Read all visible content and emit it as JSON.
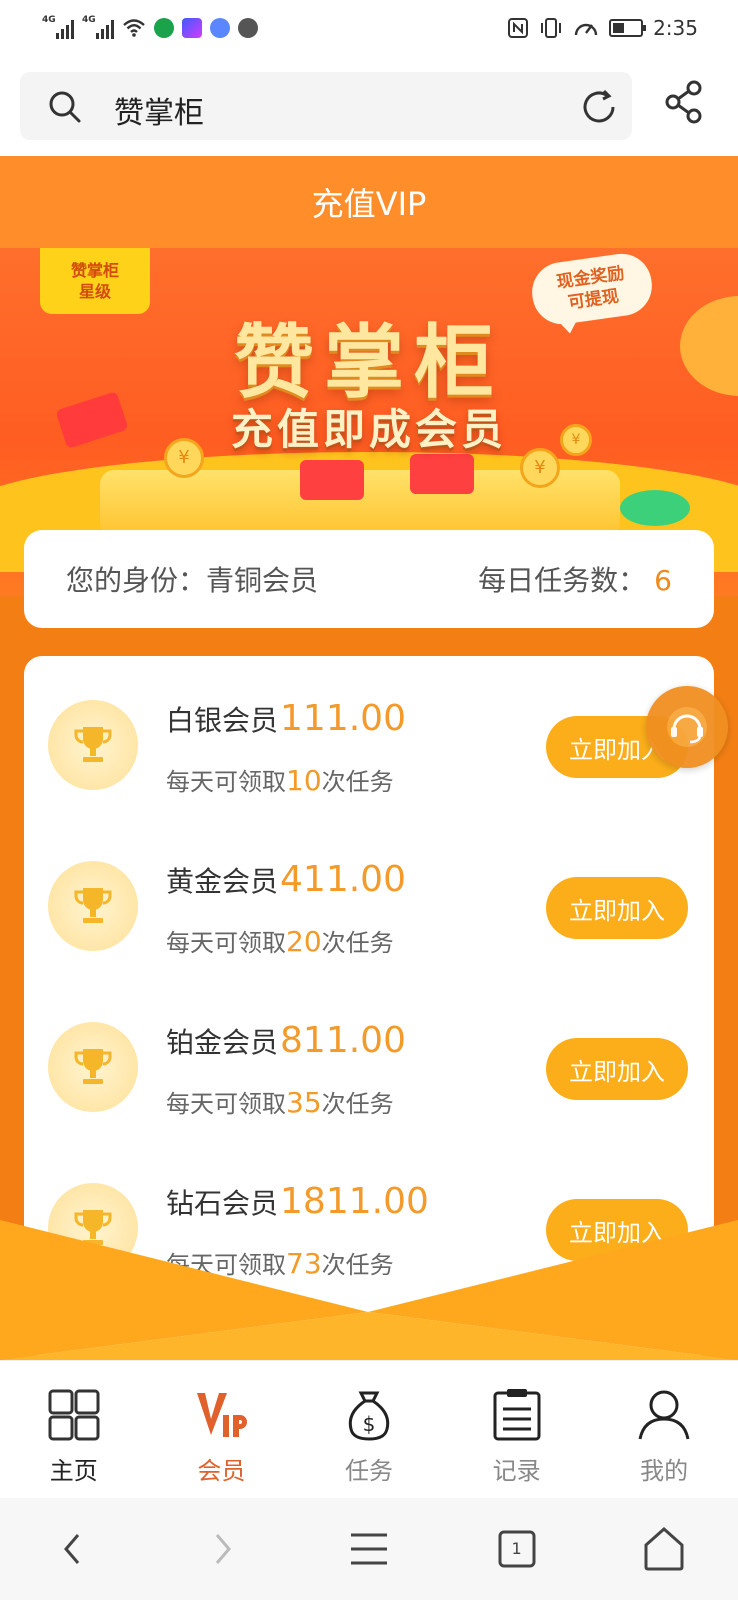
{
  "status_bar": {
    "network_1": "4G",
    "network_2": "4G",
    "time": "2:35",
    "icons": [
      "signal-icon",
      "wifi-icon",
      "app-icon",
      "music-icon",
      "nfc-icon",
      "vibrate-icon",
      "battery-icon"
    ]
  },
  "browser": {
    "search_text": "赞掌柜",
    "icons": [
      "search-icon",
      "reload-icon",
      "share-icon"
    ]
  },
  "header": {
    "title": "充值VIP"
  },
  "banner": {
    "badge_line1": "赞掌柜",
    "badge_line2": "星级",
    "bubble_line1": "现金奖励",
    "bubble_line2": "可提现",
    "title": "赞掌柜",
    "subtitle": "充值即成会员"
  },
  "identity": {
    "label": "您的身份：",
    "value": "青铜会员",
    "tasks_label": "每日任务数：",
    "tasks_value": "6"
  },
  "members": [
    {
      "name": "白银会员",
      "price": "111.00",
      "desc_prefix": "每天可领取",
      "tasks": "10",
      "desc_suffix": "次任务",
      "button": "立即加入"
    },
    {
      "name": "黄金会员",
      "price": "411.00",
      "desc_prefix": "每天可领取",
      "tasks": "20",
      "desc_suffix": "次任务",
      "button": "立即加入"
    },
    {
      "name": "铂金会员",
      "price": "811.00",
      "desc_prefix": "每天可领取",
      "tasks": "35",
      "desc_suffix": "次任务",
      "button": "立即加入"
    },
    {
      "name": "钻石会员",
      "price": "1811.00",
      "desc_prefix": "每天可领取",
      "tasks": "73",
      "desc_suffix": "次任务",
      "button": "立即加入"
    }
  ],
  "app_nav": {
    "items": [
      {
        "label": "主页",
        "icon": "grid-icon"
      },
      {
        "label": "会员",
        "icon": "vip-icon"
      },
      {
        "label": "任务",
        "icon": "money-bag-icon"
      },
      {
        "label": "记录",
        "icon": "clipboard-icon"
      },
      {
        "label": "我的",
        "icon": "user-icon"
      }
    ],
    "active_index": 1
  },
  "system_nav": {
    "tab_count": "1",
    "icons": [
      "back-icon",
      "forward-icon",
      "menu-icon",
      "tabs-icon",
      "home-icon"
    ]
  },
  "colors": {
    "orange": "#f37f14",
    "header_orange": "#ff8d2a",
    "price_orange": "#f49a2a",
    "button_yellow": "#fbae1a",
    "active_red": "#e0612b"
  }
}
